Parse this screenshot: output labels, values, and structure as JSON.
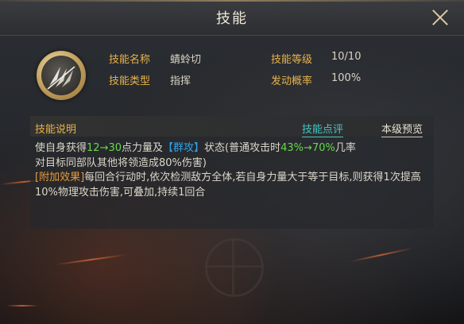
{
  "header": {
    "title": "技能"
  },
  "skill": {
    "name_label": "技能名称",
    "name": "蜻蛉切",
    "type_label": "技能类型",
    "type": "指挥",
    "level_label": "技能等级",
    "level": "10/10",
    "rate_label": "发动概率",
    "rate": "100%"
  },
  "description": {
    "title": "技能说明",
    "review_link": "技能点评",
    "preview_link": "本级预览",
    "line1": {
      "p1": "使自身获得",
      "v1": "12",
      "arrow1": "→",
      "v2": "30",
      "p2": "点力量及",
      "tag": "【群攻】",
      "p3": "状态(普通攻击时",
      "v3": "43%",
      "arrow2": "→",
      "v4": "70%",
      "p4": "几率"
    },
    "line2": "对目标同部队其他将领造成80%伤害)",
    "extra_tag": "[附加效果]",
    "extra_text": "每回合行动时,依次检测敌方全体,若自身力量大于等于目标,则获得1次提高10%物理攻击伤害,可叠加,持续1回合"
  },
  "colors": {
    "gold_label": "#e7b24c",
    "highlight_green": "#67d84a",
    "highlight_blue": "#2fa4ea",
    "link_cyan": "#45c6c2",
    "extra_orange": "#e99a3c"
  },
  "icons": {
    "close": "close-icon",
    "skill": "spear-slash-icon"
  }
}
